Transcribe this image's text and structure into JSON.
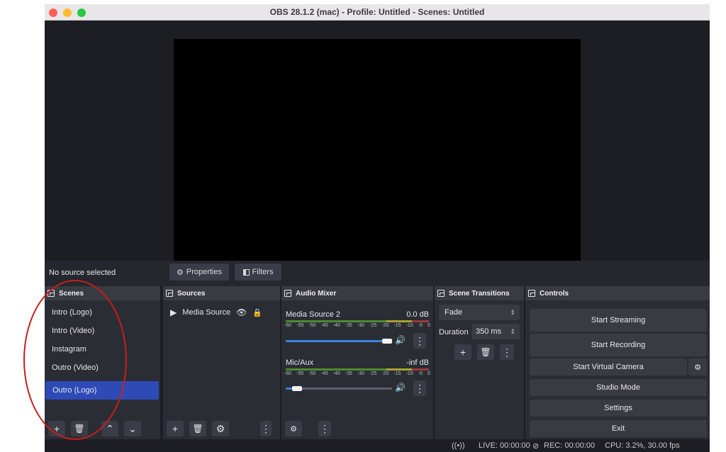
{
  "window": {
    "title": "OBS 28.1.2 (mac) - Profile: Untitled - Scenes: Untitled"
  },
  "traffic_lights": {
    "close_color": "#ff5f57",
    "minimize_color": "#febc2e",
    "zoom_color": "#28c840"
  },
  "source_bar": {
    "status": "No source selected",
    "properties_label": "Properties",
    "filters_label": "Filters"
  },
  "scenes": {
    "title": "Scenes",
    "items": [
      "Intro (Logo)",
      "Intro (Video)",
      "Instagram",
      "Outro (Video)",
      "Outro (Logo)"
    ],
    "selected": "Outro (Logo)",
    "icons": [
      "plus-icon",
      "trash-icon",
      "chevron-up-icon",
      "chevron-down-icon"
    ]
  },
  "sources": {
    "title": "Sources",
    "items": [
      {
        "label": "Media Source",
        "icon": "play-icon"
      }
    ],
    "icons": [
      "plus-icon",
      "trash-icon",
      "gear-icon",
      "more-icon"
    ]
  },
  "audio_mixer": {
    "title": "Audio Mixer",
    "channels": [
      {
        "name": "Media Source 2",
        "db": "0.0 dB",
        "volume_fraction": 1.0
      },
      {
        "name": "Mic/Aux",
        "db": "-inf dB",
        "volume_fraction": 0.15
      }
    ],
    "ticks": [
      "-60",
      "-55",
      "-50",
      "-45",
      "-40",
      "-35",
      "-30",
      "-25",
      "-20",
      "-15",
      "-10",
      "-5",
      "0"
    ]
  },
  "scene_transitions": {
    "title": "Scene Transitions",
    "transition": "Fade",
    "duration_label": "Duration",
    "duration_value": "350 ms"
  },
  "controls": {
    "title": "Controls",
    "start_streaming": "Start Streaming",
    "start_recording": "Start Recording",
    "start_virtual_camera": "Start Virtual Camera",
    "studio_mode": "Studio Mode",
    "settings": "Settings",
    "exit": "Exit"
  },
  "status_bar": {
    "live": "LIVE: 00:00:00",
    "rec": "REC: 00:00:00",
    "cpu": "CPU: 3.2%, 30.00 fps"
  },
  "annotation": {
    "color": "#c91d1d"
  }
}
